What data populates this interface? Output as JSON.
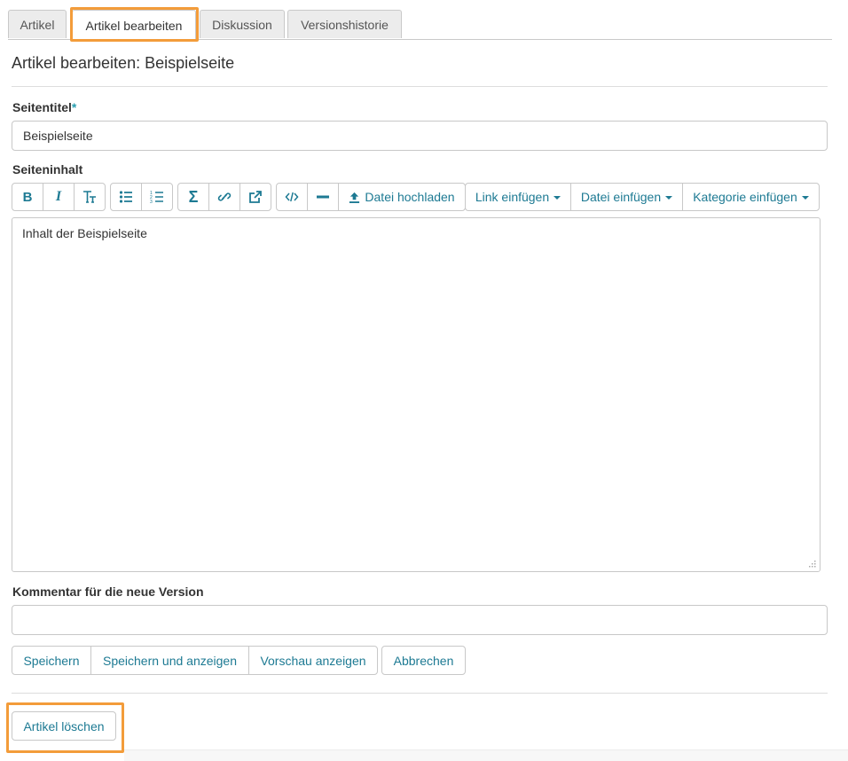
{
  "tabs": [
    {
      "label": "Artikel"
    },
    {
      "label": "Artikel bearbeiten"
    },
    {
      "label": "Diskussion"
    },
    {
      "label": "Versionshistorie"
    }
  ],
  "page": {
    "title": "Artikel bearbeiten: Beispielseite"
  },
  "form": {
    "title_label": "Seitentitel",
    "required_mark": "*",
    "title_value": "Beispielseite",
    "content_label": "Seiteninhalt",
    "content_value": "Inhalt der Beispielseite",
    "comment_label": "Kommentar für die neue Version",
    "comment_value": ""
  },
  "toolbar": {
    "upload_label": "Datei hochladen",
    "link_insert_label": "Link einfügen",
    "file_insert_label": "Datei einfügen",
    "category_insert_label": "Kategorie einfügen",
    "icons": [
      "bold-icon",
      "italic-icon",
      "heading-icon",
      "bullet-list-icon",
      "numbered-list-icon",
      "sigma-icon",
      "link-icon",
      "external-link-icon",
      "code-icon",
      "horizontal-rule-icon",
      "upload-icon"
    ]
  },
  "actions": {
    "save": "Speichern",
    "save_and_view": "Speichern und anzeigen",
    "preview": "Vorschau anzeigen",
    "cancel": "Abbrechen",
    "delete": "Artikel löschen"
  },
  "colors": {
    "accent": "#1d7a93",
    "highlight": "#f39c3a",
    "required": "#2a9fb0"
  }
}
